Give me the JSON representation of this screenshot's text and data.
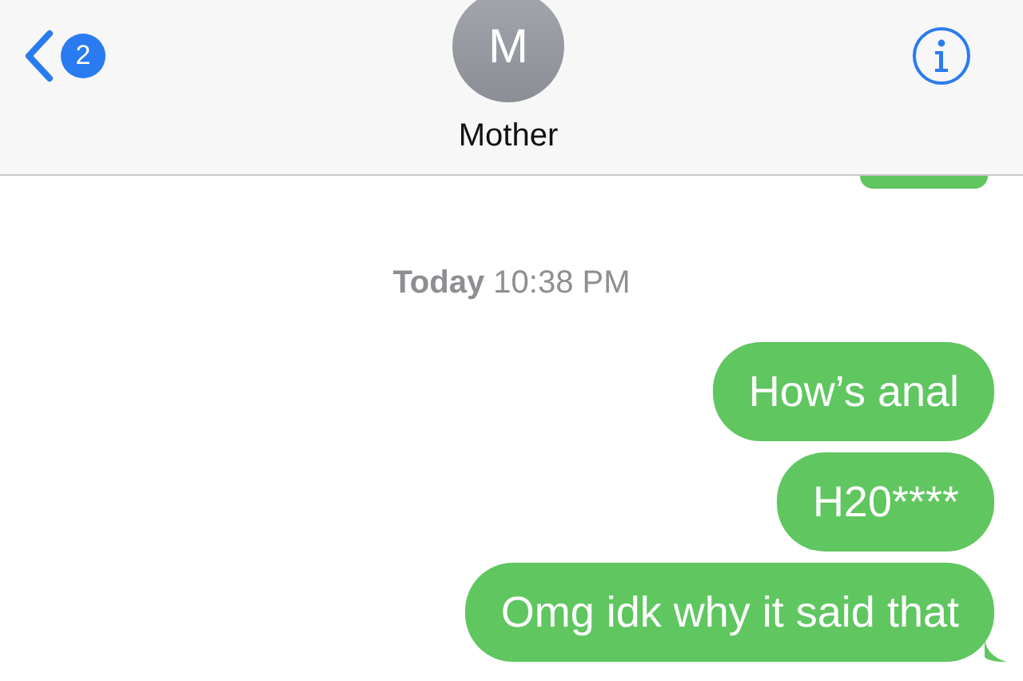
{
  "header": {
    "back_badge": "2",
    "avatar_initial": "M",
    "contact_name": "Mother"
  },
  "timestamp": "**Today** 10:38 PM",
  "messages": [
    {
      "text": "How’s anal",
      "tail": false
    },
    {
      "text": "H20****",
      "tail": false
    },
    {
      "text": "Omg idk why it said that",
      "tail": true
    }
  ]
}
